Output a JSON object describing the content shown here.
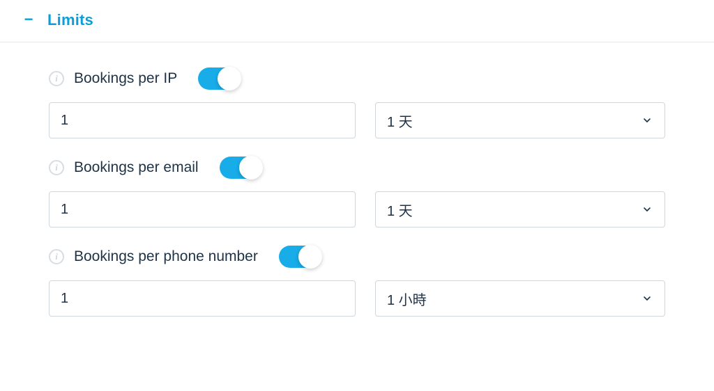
{
  "section": {
    "title": "Limits",
    "collapse_glyph": "−"
  },
  "limits": [
    {
      "label": "Bookings per IP",
      "toggle_on": true,
      "count": "1",
      "period": "1 天"
    },
    {
      "label": "Bookings per email",
      "toggle_on": true,
      "count": "1",
      "period": "1 天"
    },
    {
      "label": "Bookings per phone number",
      "toggle_on": true,
      "count": "1",
      "period": "1 小時"
    }
  ]
}
